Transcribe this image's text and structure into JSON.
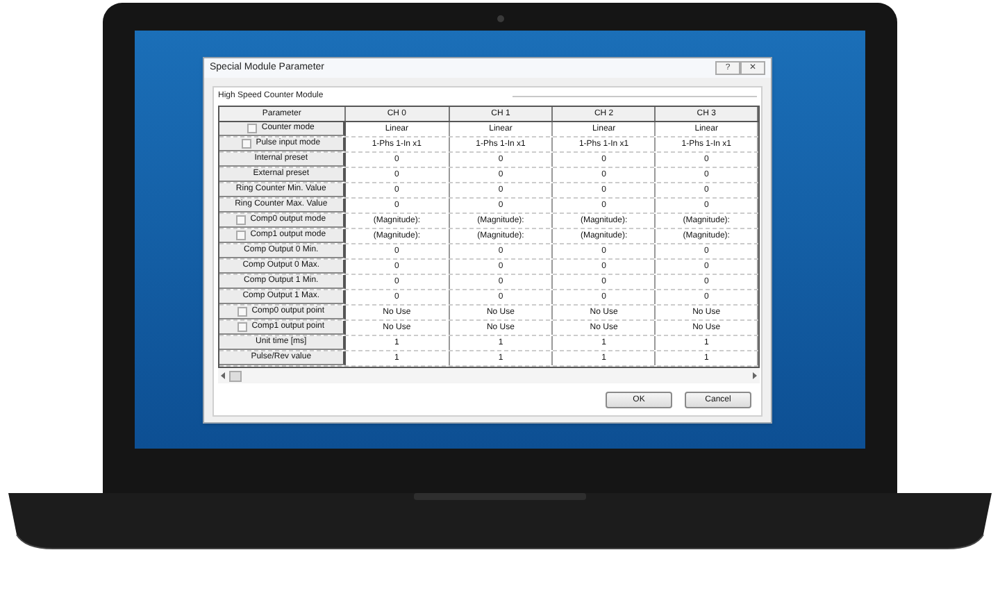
{
  "window": {
    "title": "Special Module Parameter",
    "buttons": [
      "?",
      "✕"
    ]
  },
  "group_title": "High Speed Counter Module",
  "table": {
    "columns": [
      "Parameter",
      "CH 0",
      "CH 1",
      "CH 2",
      "CH 3"
    ],
    "rows": [
      {
        "kind": "checkbox",
        "checked": false,
        "parameter": "Counter mode",
        "values": [
          "Linear",
          "Linear",
          "Linear",
          "Linear"
        ]
      },
      {
        "kind": "checkbox",
        "checked": false,
        "parameter": "Pulse input mode",
        "values": [
          "1-Phs 1-In x1",
          "1-Phs 1-In x1",
          "1-Phs 1-In x1",
          "1-Phs 1-In x1"
        ]
      },
      {
        "kind": "plain",
        "parameter": "Internal preset",
        "values": [
          "0",
          "0",
          "0",
          "0"
        ]
      },
      {
        "kind": "plain",
        "parameter": "External preset",
        "values": [
          "0",
          "0",
          "0",
          "0"
        ]
      },
      {
        "kind": "plain",
        "parameter": "Ring Counter Min. Value",
        "values": [
          "0",
          "0",
          "0",
          "0"
        ]
      },
      {
        "kind": "plain",
        "parameter": "Ring Counter Max. Value",
        "values": [
          "0",
          "0",
          "0",
          "0"
        ]
      },
      {
        "kind": "checkbox",
        "checked": false,
        "parameter": "Comp0 output mode",
        "values": [
          "(Magnitude):",
          "(Magnitude):",
          "(Magnitude):",
          "(Magnitude):"
        ]
      },
      {
        "kind": "checkbox",
        "checked": false,
        "parameter": "Comp1 output mode",
        "values": [
          "(Magnitude):",
          "(Magnitude):",
          "(Magnitude):",
          "(Magnitude):"
        ]
      },
      {
        "kind": "plain",
        "parameter": "Comp Output 0 Min.",
        "values": [
          "0",
          "0",
          "0",
          "0"
        ]
      },
      {
        "kind": "plain",
        "parameter": "Comp Output 0 Max.",
        "values": [
          "0",
          "0",
          "0",
          "0"
        ]
      },
      {
        "kind": "plain",
        "parameter": "Comp Output 1 Min.",
        "values": [
          "0",
          "0",
          "0",
          "0"
        ]
      },
      {
        "kind": "plain",
        "parameter": "Comp Output 1 Max.",
        "values": [
          "0",
          "0",
          "0",
          "0"
        ]
      },
      {
        "kind": "checkbox",
        "checked": false,
        "parameter": "Comp0 output point",
        "values": [
          "No Use",
          "No Use",
          "No Use",
          "No Use"
        ]
      },
      {
        "kind": "checkbox",
        "checked": false,
        "parameter": "Comp1 output point",
        "values": [
          "No Use",
          "No Use",
          "No Use",
          "No Use"
        ]
      },
      {
        "kind": "plain",
        "parameter": "Unit time [ms]",
        "values": [
          "1",
          "1",
          "1",
          "1"
        ]
      },
      {
        "kind": "plain",
        "parameter": "Pulse/Rev value",
        "values": [
          "1",
          "1",
          "1",
          "1"
        ]
      }
    ]
  },
  "buttons": [
    "OK",
    "Cancel"
  ]
}
